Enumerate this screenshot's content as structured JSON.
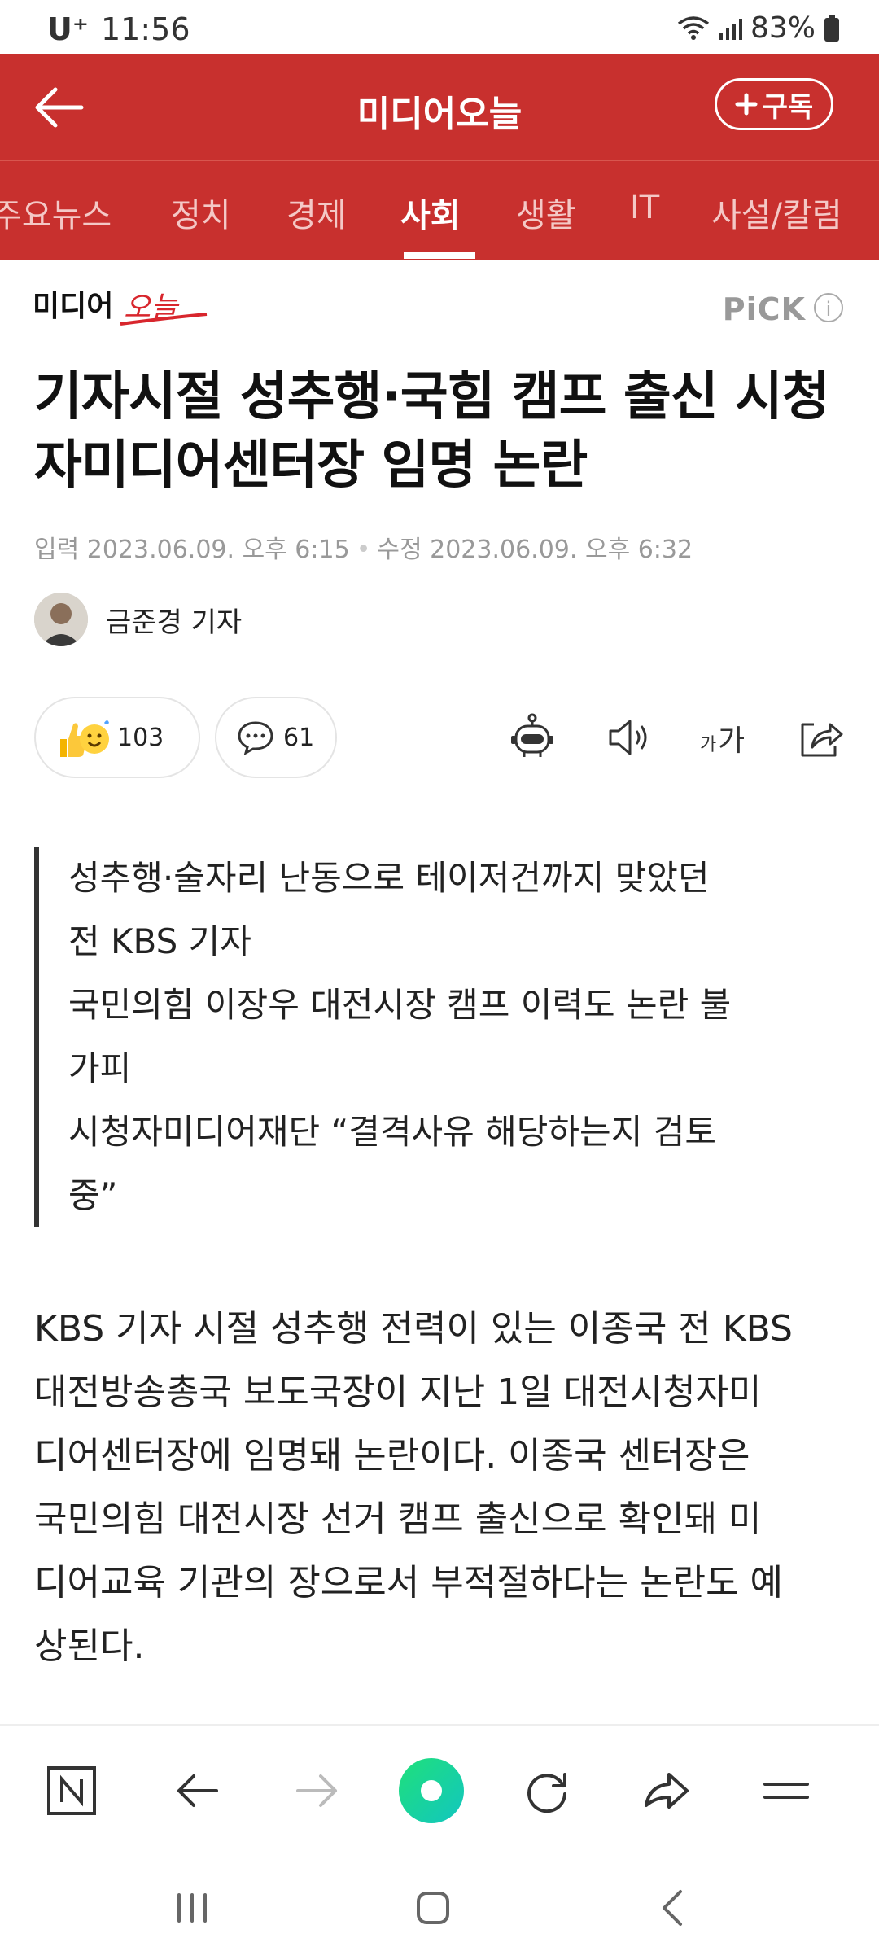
{
  "status_bar": {
    "carrier": "U⁺",
    "time": "11:56",
    "battery": "83%"
  },
  "header": {
    "title": "미디어오늘",
    "subscribe_label": "구독"
  },
  "tabs": [
    "주요뉴스",
    "정치",
    "경제",
    "사회",
    "생활",
    "IT",
    "사설/칼럼"
  ],
  "active_tab": "사회",
  "brand": {
    "pick_label": "PiCK"
  },
  "article": {
    "headline": "기자시절 성추행·국힘 캠프 출신 시청자미디어센터장 임명 논란",
    "published": "입력 2023.06.09. 오후 6:15",
    "modified": "수정 2023.06.09. 오후 6:32",
    "author": "금준경 기자",
    "reaction_count": "103",
    "comment_count": "61",
    "summary": [
      "성추행·술자리 난동으로 테이저건까지 맞았던",
      "전 KBS 기자",
      "국민의힘 이장우 대전시장 캠프 이력도 논란 불",
      "가피",
      "시청자미디어재단 “결격사유 해당하는지 검토",
      "중”"
    ],
    "body_lines": [
      "KBS 기자 시절 성추행 전력이 있는 이종국 전 KBS",
      "대전방송총국 보도국장이 지난 1일 대전시청자미",
      "디어센터장에 임명돼 논란이다. 이종국 센터장은",
      "국민의힘 대전시장 선거 캠프 출신으로 확인돼 미",
      "디어교육 기관의 장으로서 부적절하다는 논란도 예",
      "상된다."
    ]
  },
  "toolbar": {
    "font_size_label": "가가"
  },
  "colors": {
    "brand_red": "#c8302e",
    "text_gray": "#999999"
  },
  "icons": [
    "back-arrow-icon",
    "plus-icon",
    "robot-icon",
    "speaker-icon",
    "font-size-icon",
    "share-icon",
    "naver-n-icon",
    "nav-back-icon",
    "nav-forward-icon",
    "green-dot-icon",
    "refresh-icon",
    "nav-share-icon",
    "menu-icon",
    "recent-apps-icon",
    "home-icon",
    "system-back-icon"
  ]
}
